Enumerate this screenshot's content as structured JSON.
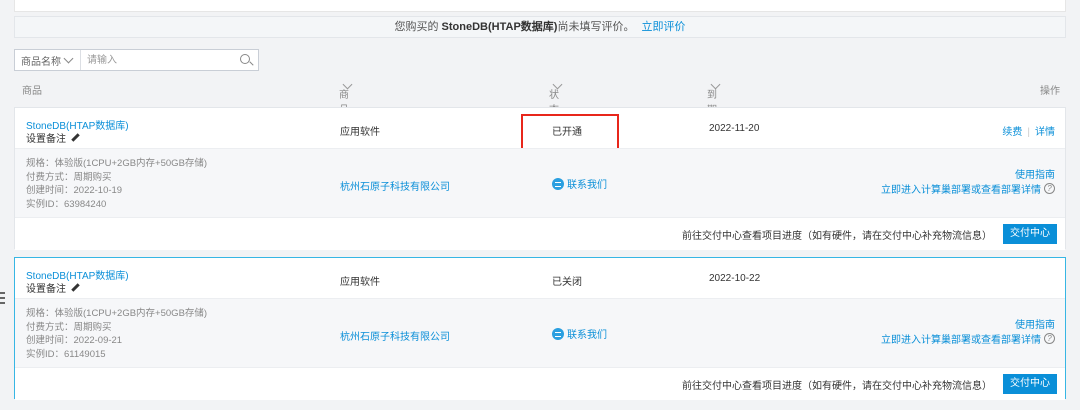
{
  "notice": {
    "prefix": "您购买的 ",
    "product": "StoneDB(HTAP数据库)",
    "suffix": "尚未填写评价。",
    "link": "立即评价"
  },
  "search": {
    "field_label": "商品名称",
    "placeholder": "请输入"
  },
  "table_header": {
    "product": "商品",
    "type": "商品类型(全部)",
    "status": "状态(全部状态)",
    "expiry": "到期时间(全部)",
    "actions": "操作"
  },
  "rows": [
    {
      "name": "StoneDB(HTAP数据库)",
      "remark": "设置备注",
      "type": "应用软件",
      "status": "已开通",
      "expiry": "2022-11-20",
      "action_renew": "续费",
      "action_detail": "详情",
      "spec": "规格：体验版(1CPU+2GB内存+50GB存储)",
      "pay": "付费方式：周期购买",
      "created": "创建时间：2022-10-19",
      "instance": "实例ID：63984240",
      "company": "杭州石原子科技有限公司",
      "contact": "联系我们",
      "guide": "使用指南",
      "deploy": "立即进入计算巢部署或查看部署详情",
      "delivery_text": "前往交付中心查看项目进度（如有硬件，请在交付中心补充物流信息）",
      "delivery_button": "交付中心"
    },
    {
      "name": "StoneDB(HTAP数据库)",
      "remark": "设置备注",
      "type": "应用软件",
      "status": "已关闭",
      "expiry": "2022-10-22",
      "spec": "规格：体验版(1CPU+2GB内存+50GB存储)",
      "pay": "付费方式：周期购买",
      "created": "创建时间：2022-09-21",
      "instance": "实例ID：61149015",
      "company": "杭州石原子科技有限公司",
      "contact": "联系我们",
      "guide": "使用指南",
      "deploy": "立即进入计算巢部署或查看部署详情",
      "delivery_text": "前往交付中心查看项目进度（如有硬件，请在交付中心补充物流信息）",
      "delivery_button": "交付中心"
    }
  ],
  "colors": {
    "link": "#0a8fd8",
    "highlight": "#e8261b",
    "selected_border": "#37b6e4"
  }
}
